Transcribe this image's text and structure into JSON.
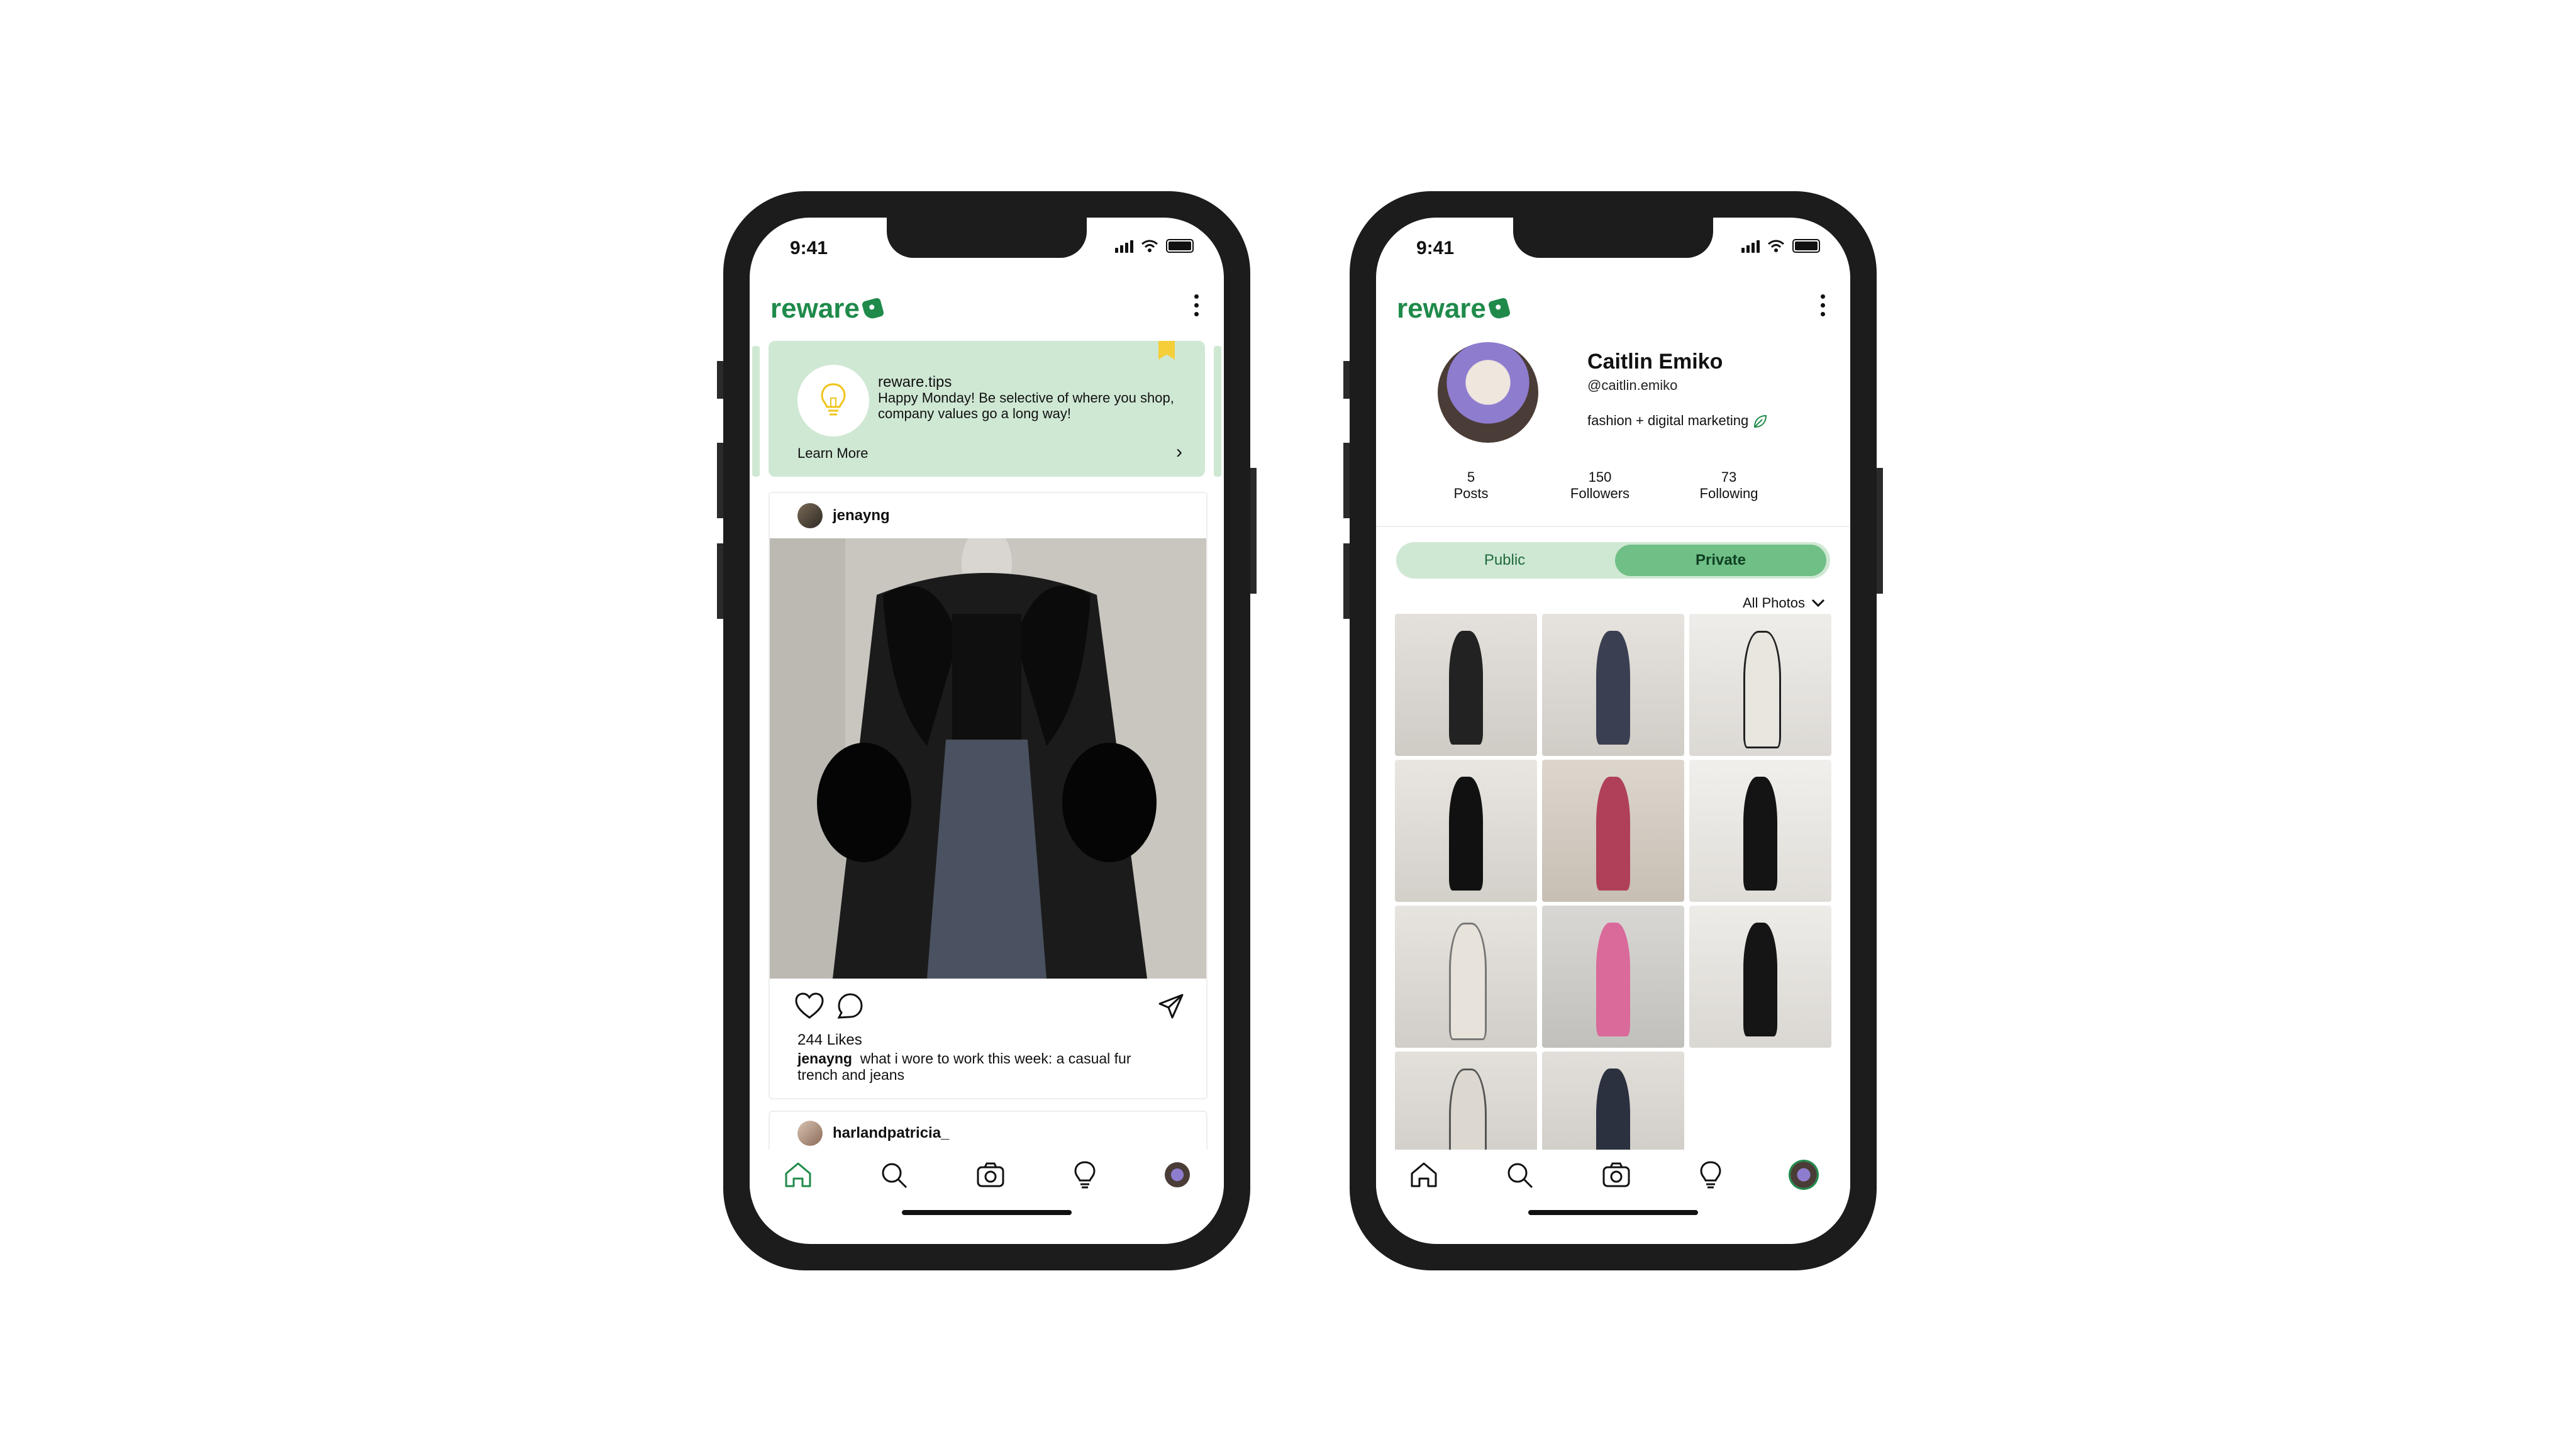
{
  "feed_screen": {
    "status": {
      "time": "9:41"
    },
    "header": {
      "logo_text": "reware"
    },
    "tips_card": {
      "handle": "reware.tips",
      "message": "Happy Monday! Be selective of where you shop, company values go a long way!",
      "learn_more": "Learn More"
    },
    "post": {
      "username": "jenayng",
      "likes": "244 Likes",
      "caption_user": "jenayng",
      "caption_text": "what i wore to work this week: a casual fur trench and jeans"
    },
    "next_post": {
      "username": "harlandpatricia_"
    },
    "nav": [
      "home-icon",
      "search-icon",
      "camera-icon",
      "lightbulb-icon",
      "profile-avatar"
    ]
  },
  "profile_screen": {
    "status": {
      "time": "9:41"
    },
    "header": {
      "logo_text": "reware"
    },
    "profile": {
      "name": "Caitlin Emiko",
      "handle": "@caitlin.emiko",
      "bio": "fashion + digital marketing"
    },
    "stats": [
      {
        "value": "5",
        "label": "Posts"
      },
      {
        "value": "150",
        "label": "Followers"
      },
      {
        "value": "73",
        "label": "Following"
      }
    ],
    "visibility_toggle": {
      "public": "Public",
      "private": "Private",
      "selected": "Private"
    },
    "filter": {
      "label": "All Photos"
    },
    "photo_count": 11
  },
  "colors": {
    "brand_green": "#1f8a4a",
    "tips_background": "#cfe8d4",
    "toggle_selected": "#6fbf86",
    "bookmark_yellow": "#f4cf3a"
  }
}
